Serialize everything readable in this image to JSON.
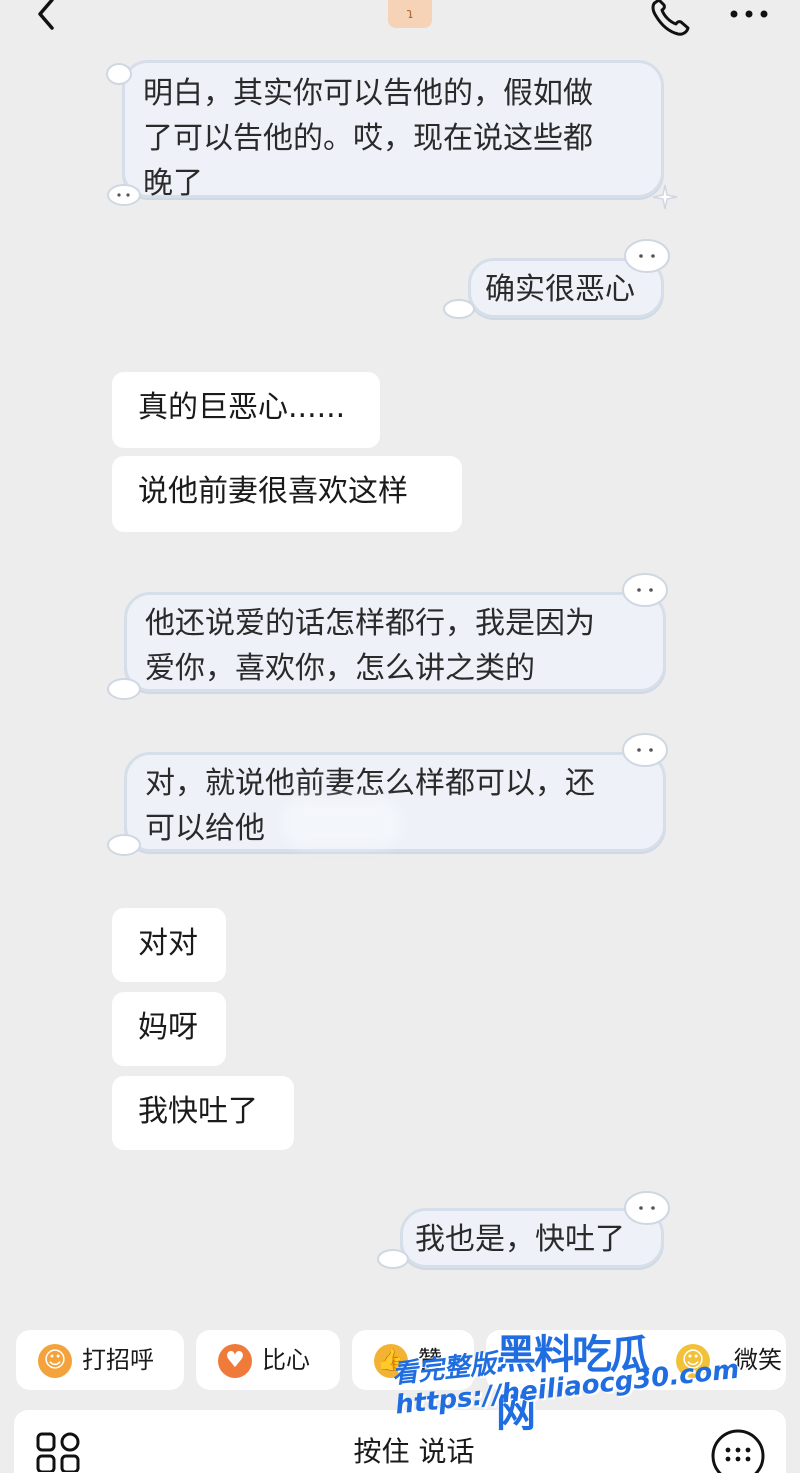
{
  "header": {
    "avatar_glyph": "ɿ"
  },
  "messages": [
    {
      "id": "m1",
      "side": "left",
      "style": "cute",
      "text": "明白，其实你可以告他的，假如做\n了可以告他的。哎，现在说这些都\n晚了"
    },
    {
      "id": "m2",
      "side": "right",
      "style": "cute",
      "text": "确实很恶心"
    },
    {
      "id": "m3",
      "side": "left",
      "style": "plain",
      "text": "真的巨恶心......"
    },
    {
      "id": "m4",
      "side": "left",
      "style": "plain",
      "text": "说他前妻很喜欢这样"
    },
    {
      "id": "m5",
      "side": "left",
      "style": "cute",
      "text": "他还说爱的话怎样都行，我是因为\n爱你，喜欢你，怎么讲之类的"
    },
    {
      "id": "m6",
      "side": "left",
      "style": "cute",
      "text": "对，就说他前妻怎么样都可以，还\n可以给他"
    },
    {
      "id": "m7",
      "side": "left",
      "style": "plain",
      "text": "对对"
    },
    {
      "id": "m8",
      "side": "left",
      "style": "plain",
      "text": "妈呀"
    },
    {
      "id": "m9",
      "side": "left",
      "style": "plain",
      "text": "我快吐了"
    },
    {
      "id": "m10",
      "side": "right",
      "style": "cute",
      "text": "我也是，快吐了"
    }
  ],
  "quick_replies": [
    {
      "label": "打招呼",
      "icon": "smile-emoji-icon",
      "glyph": "☺",
      "color": "#f4a23b"
    },
    {
      "label": "比心",
      "icon": "heart-hands-emoji-icon",
      "glyph": "♥",
      "color": "#f07a3a"
    },
    {
      "label": "赞",
      "icon": "thumbs-up-emoji-icon",
      "glyph": "👍",
      "color": "#f2b233"
    },
    {
      "label": "微笑",
      "icon": "smile-face-emoji-icon",
      "glyph": "☺",
      "color": "#f2c13a"
    }
  ],
  "input": {
    "hold_to_talk": "按住 说话"
  },
  "watermark": {
    "logo": "黑料吃瓜网",
    "url": "看完整版: https://heiliaocg30.com"
  },
  "colors": {
    "background": "#ededed",
    "cute_bubble": "#eef2f8",
    "cute_border": "#d6deea",
    "plain_bubble": "#ffffff",
    "watermark": "#1f6de0"
  }
}
